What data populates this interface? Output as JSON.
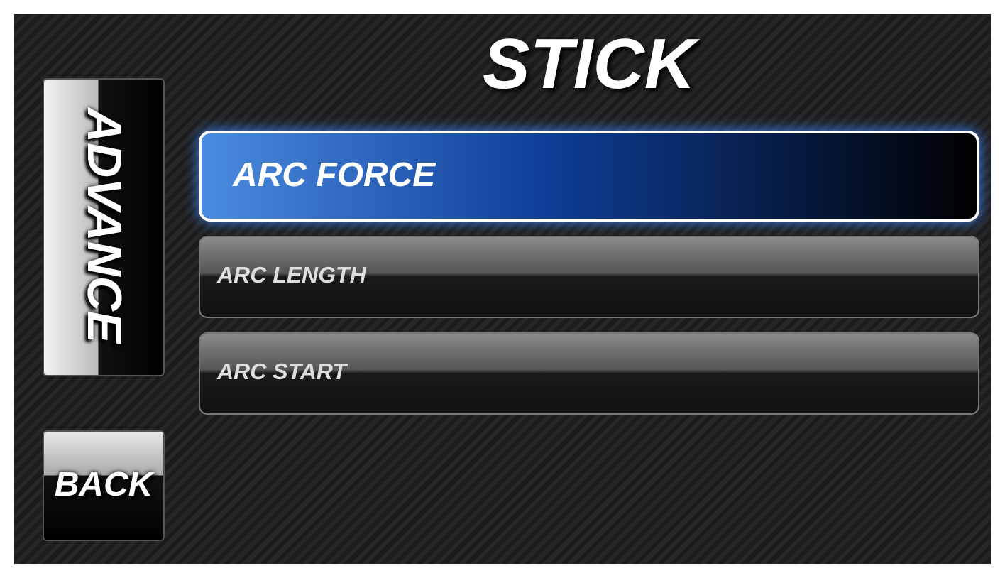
{
  "title": "STICK",
  "side_tab": {
    "label": "ADVANCE",
    "selected": true
  },
  "back_button": {
    "label": "BACK"
  },
  "menu": [
    {
      "label": "ARC FORCE",
      "selected": true
    },
    {
      "label": "ARC LENGTH",
      "selected": false
    },
    {
      "label": "ARC START",
      "selected": false
    }
  ]
}
